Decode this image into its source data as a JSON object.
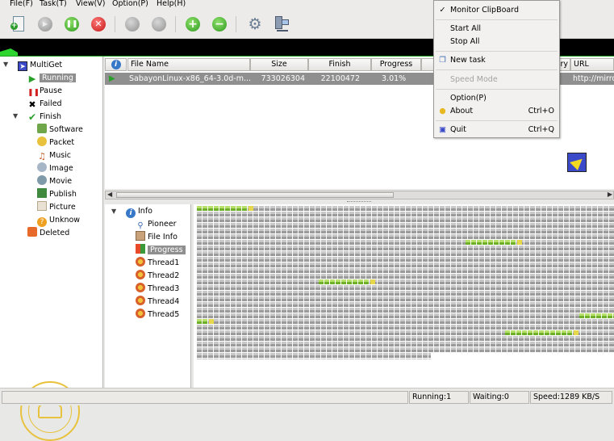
{
  "menubar": {
    "file": "File(F)",
    "task": "Task(T)",
    "view": "View(V)",
    "option": "Option(P)",
    "help": "Help(H)"
  },
  "toolbar": {
    "buttons": [
      {
        "name": "new-task-icon"
      },
      {
        "name": "start-icon"
      },
      {
        "name": "pause-icon"
      },
      {
        "name": "delete-icon"
      },
      {
        "name": "move-up-icon"
      },
      {
        "name": "move-down-icon"
      },
      {
        "name": "add-thread-icon"
      },
      {
        "name": "remove-thread-icon"
      },
      {
        "name": "settings-icon"
      },
      {
        "name": "network-icon"
      }
    ]
  },
  "tree": {
    "root": "MultiGet",
    "running": "Running",
    "pause": "Pause",
    "failed": "Failed",
    "finish": "Finish",
    "software": "Software",
    "packet": "Packet",
    "music": "Music",
    "image": "Image",
    "movie": "Movie",
    "publish": "Publish",
    "picture": "Picture",
    "unknow": "Unknow",
    "deleted": "Deleted"
  },
  "table": {
    "columns": [
      "File Name",
      "Size",
      "Finish",
      "Progress",
      "ry",
      "URL"
    ],
    "rows": [
      {
        "file": "SabayonLinux-x86_64-3.0d-m...",
        "size": "733026304",
        "finish": "22100472",
        "progress": "3.01%",
        "url": "http://mirro"
      }
    ]
  },
  "info_tree": {
    "info": "Info",
    "pioneer": "Pioneer",
    "file_info": "File Info",
    "progress": "Progress",
    "thread1": "Thread1",
    "thread2": "Thread2",
    "thread3": "Thread3",
    "thread4": "Thread4",
    "thread5": "Thread5"
  },
  "statusbar": {
    "running": "Running:1",
    "waiting": "Waiting:0",
    "speed": "Speed:1289 KB/S"
  },
  "tray_menu": {
    "monitor": "Monitor ClipBoard",
    "monitor_checked": true,
    "start_all": "Start All",
    "stop_all": "Stop All",
    "new_task": "New task",
    "speed_mode": "Speed Mode",
    "option": "Option(P)",
    "about": "About",
    "about_accel": "Ctrl+O",
    "quit": "Quit",
    "quit_accel": "Ctrl+Q"
  },
  "colors": {
    "selection": "#8f8f8f",
    "progress_done": "#6fb02a",
    "progress_tip": "#e6d84a",
    "graph": "#2ed52e"
  }
}
